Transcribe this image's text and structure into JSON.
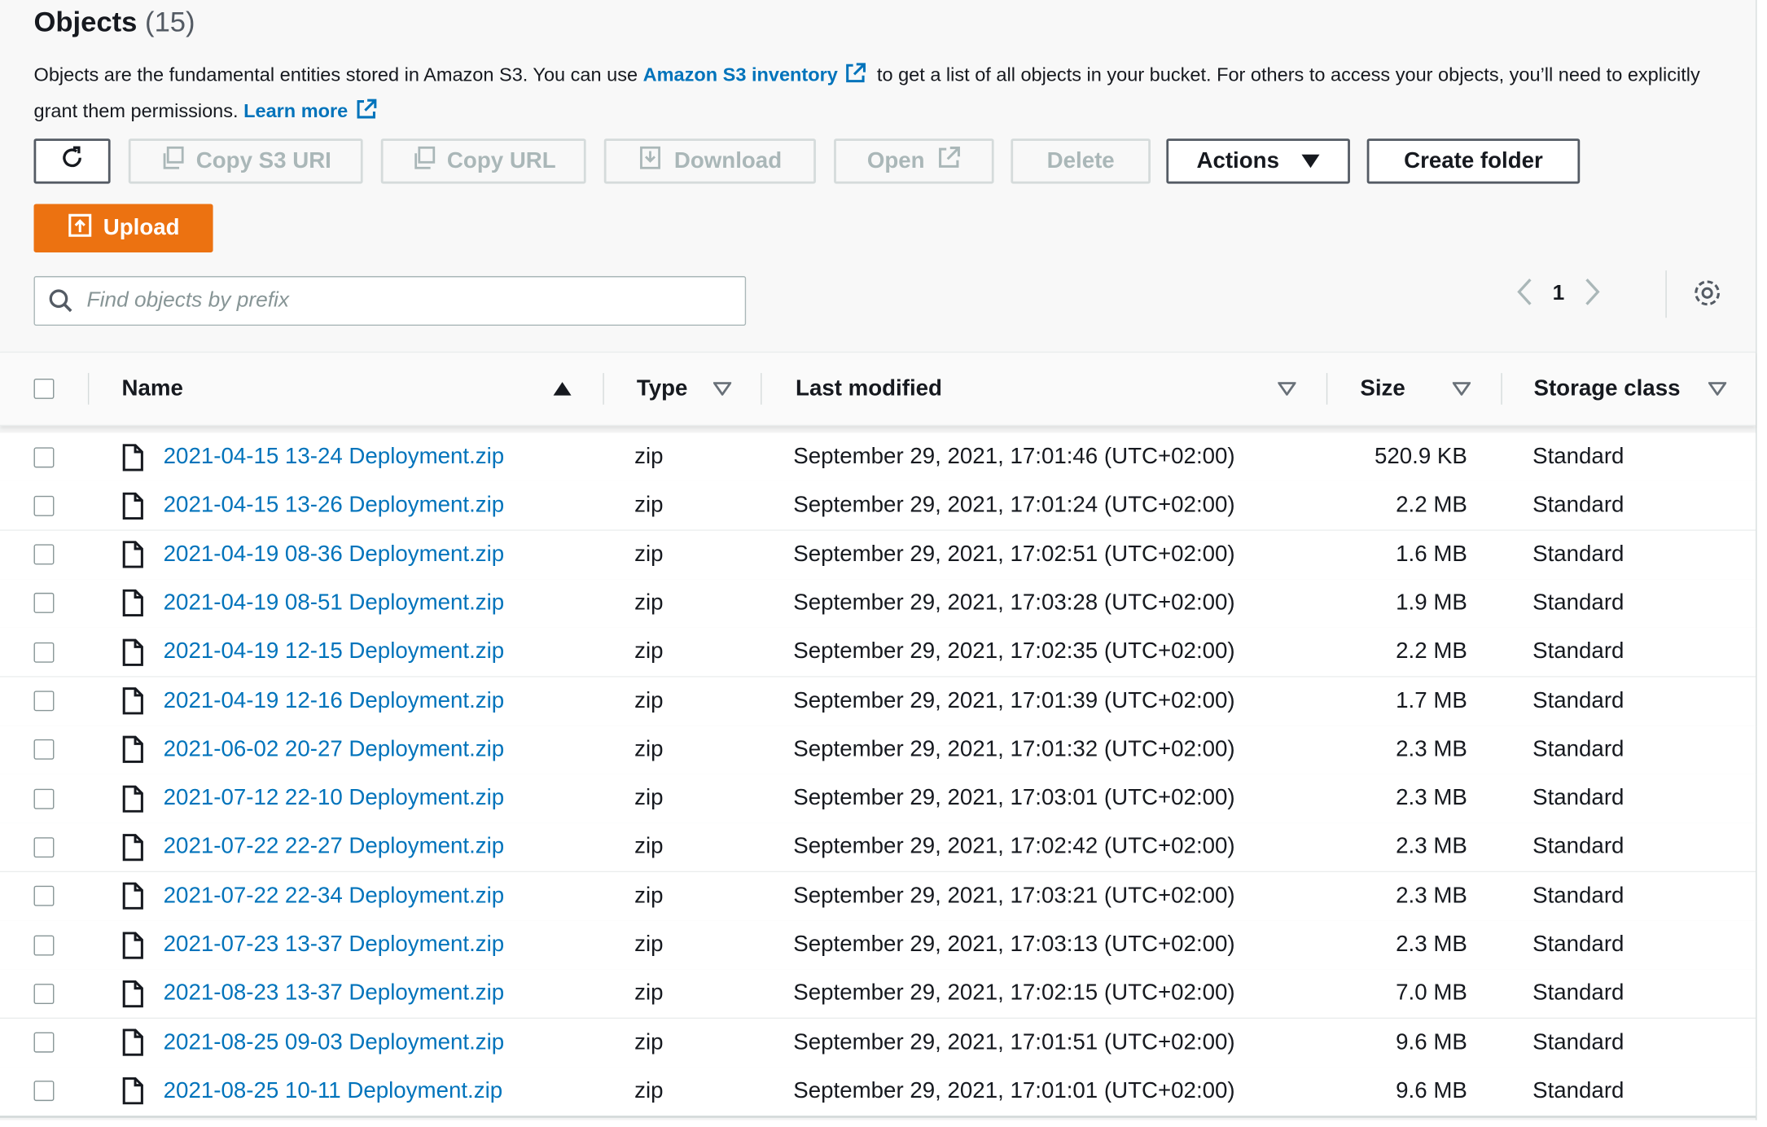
{
  "header": {
    "title": "Objects",
    "count": "(15)",
    "desc_part1": "Objects are the fundamental entities stored in Amazon S3. You can use ",
    "inventory_link": "Amazon S3 inventory",
    "desc_part2": " to get a list of all objects in your bucket. For others to access your objects, you’ll need to explicitly grant them permissions. ",
    "learn_more": "Learn more"
  },
  "toolbar": {
    "copy_s3_uri": "Copy S3 URI",
    "copy_url": "Copy URL",
    "download": "Download",
    "open": "Open",
    "delete": "Delete",
    "actions": "Actions",
    "create_folder": "Create folder",
    "upload": "Upload"
  },
  "search": {
    "placeholder": "Find objects by prefix"
  },
  "pagination": {
    "current_page": "1"
  },
  "table": {
    "columns": [
      "Name",
      "Type",
      "Last modified",
      "Size",
      "Storage class"
    ],
    "rows": [
      {
        "name": "2021-04-15 13-24 Deployment.zip",
        "type": "zip",
        "modified": "September 29, 2021, 17:01:46 (UTC+02:00)",
        "size": "520.9 KB",
        "storage": "Standard"
      },
      {
        "name": "2021-04-15 13-26 Deployment.zip",
        "type": "zip",
        "modified": "September 29, 2021, 17:01:24 (UTC+02:00)",
        "size": "2.2 MB",
        "storage": "Standard"
      },
      {
        "name": "2021-04-19 08-36 Deployment.zip",
        "type": "zip",
        "modified": "September 29, 2021, 17:02:51 (UTC+02:00)",
        "size": "1.6 MB",
        "storage": "Standard"
      },
      {
        "name": "2021-04-19 08-51 Deployment.zip",
        "type": "zip",
        "modified": "September 29, 2021, 17:03:28 (UTC+02:00)",
        "size": "1.9 MB",
        "storage": "Standard"
      },
      {
        "name": "2021-04-19 12-15 Deployment.zip",
        "type": "zip",
        "modified": "September 29, 2021, 17:02:35 (UTC+02:00)",
        "size": "2.2 MB",
        "storage": "Standard"
      },
      {
        "name": "2021-04-19 12-16 Deployment.zip",
        "type": "zip",
        "modified": "September 29, 2021, 17:01:39 (UTC+02:00)",
        "size": "1.7 MB",
        "storage": "Standard"
      },
      {
        "name": "2021-06-02 20-27 Deployment.zip",
        "type": "zip",
        "modified": "September 29, 2021, 17:01:32 (UTC+02:00)",
        "size": "2.3 MB",
        "storage": "Standard"
      },
      {
        "name": "2021-07-12 22-10 Deployment.zip",
        "type": "zip",
        "modified": "September 29, 2021, 17:03:01 (UTC+02:00)",
        "size": "2.3 MB",
        "storage": "Standard"
      },
      {
        "name": "2021-07-22 22-27 Deployment.zip",
        "type": "zip",
        "modified": "September 29, 2021, 17:02:42 (UTC+02:00)",
        "size": "2.3 MB",
        "storage": "Standard"
      },
      {
        "name": "2021-07-22 22-34 Deployment.zip",
        "type": "zip",
        "modified": "September 29, 2021, 17:03:21 (UTC+02:00)",
        "size": "2.3 MB",
        "storage": "Standard"
      },
      {
        "name": "2021-07-23 13-37 Deployment.zip",
        "type": "zip",
        "modified": "September 29, 2021, 17:03:13 (UTC+02:00)",
        "size": "2.3 MB",
        "storage": "Standard"
      },
      {
        "name": "2021-08-23 13-37 Deployment.zip",
        "type": "zip",
        "modified": "September 29, 2021, 17:02:15 (UTC+02:00)",
        "size": "7.0 MB",
        "storage": "Standard"
      },
      {
        "name": "2021-08-25 09-03 Deployment.zip",
        "type": "zip",
        "modified": "September 29, 2021, 17:01:51 (UTC+02:00)",
        "size": "9.6 MB",
        "storage": "Standard"
      },
      {
        "name": "2021-08-25 10-11 Deployment.zip",
        "type": "zip",
        "modified": "September 29, 2021, 17:01:01 (UTC+02:00)",
        "size": "9.6 MB",
        "storage": "Standard"
      }
    ]
  },
  "colors": {
    "link": "#0073bb",
    "primary": "#ec7211",
    "disabled": "#aab7b8"
  }
}
